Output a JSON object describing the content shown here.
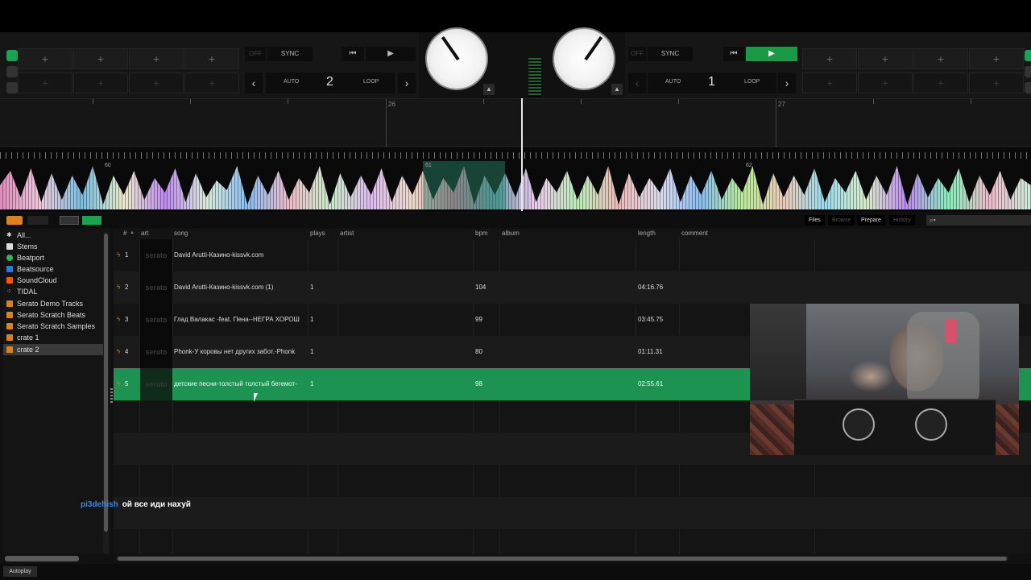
{
  "deck_left": {
    "sync_label": "SYNC",
    "off_label": "OFF",
    "auto_label": "AUTO",
    "loop_label": "LOOP",
    "loop_length": "2",
    "hotcue_label": "+"
  },
  "deck_right": {
    "sync_label": "SYNC",
    "off_label": "OFF",
    "auto_label": "AUTO",
    "loop_label": "LOOP",
    "loop_length": "1",
    "hotcue_label": "+"
  },
  "icons": {
    "prev_arrow": "‹",
    "next_arrow": "›",
    "cue": "⏮",
    "play": "▶",
    "eject": "▲",
    "bolt": "ϟ"
  },
  "overview": {
    "bar_labels": [
      "26",
      "27"
    ]
  },
  "waveform": {
    "bar_labels": [
      "60",
      "61",
      "62"
    ]
  },
  "library": {
    "tabs": [
      "Files",
      "Browse",
      "Prepare",
      "History"
    ],
    "search_icon": "search-icon"
  },
  "sidebar": {
    "items": [
      {
        "label": "All...",
        "icon": "star-icon",
        "color": "#dddddd"
      },
      {
        "label": "Stems",
        "icon": "stems-icon",
        "color": "#dddddd"
      },
      {
        "label": "Beatport",
        "icon": "beatport-icon",
        "color": "#3bb05a"
      },
      {
        "label": "Beatsource",
        "icon": "beatsource-icon",
        "color": "#2a7be0"
      },
      {
        "label": "SoundCloud",
        "icon": "soundcloud-icon",
        "color": "#ff5500"
      },
      {
        "label": "TIDAL",
        "icon": "tidal-icon",
        "color": "#dddddd"
      },
      {
        "label": "Serato Demo Tracks",
        "icon": "crate-icon",
        "color": "#d9821e"
      },
      {
        "label": "Serato Scratch Beats",
        "icon": "crate-icon",
        "color": "#d9821e"
      },
      {
        "label": "Serato Scratch Samples",
        "icon": "crate-icon",
        "color": "#d9821e"
      },
      {
        "label": "crate 1",
        "icon": "crate-icon",
        "color": "#d9821e"
      },
      {
        "label": "crate 2",
        "icon": "crate-icon",
        "color": "#d9821e"
      }
    ]
  },
  "table": {
    "headers": {
      "num": "#",
      "art": "art",
      "song": "song",
      "plays": "plays",
      "artist": "artist",
      "bpm": "bpm",
      "album": "album",
      "length": "length",
      "comment": "comment"
    },
    "art_placeholder": "serato",
    "rows": [
      {
        "num": "1",
        "song": "David Arutti-Казино-kissvk.com",
        "plays": "",
        "bpm": "",
        "length": ""
      },
      {
        "num": "2",
        "song": "David Arutti-Казино-kissvk.com (1)",
        "plays": "1",
        "bpm": "104",
        "length": "04:16.76"
      },
      {
        "num": "3",
        "song": "Глад Валакас -feat. Пена--НЕГРА ХОРОШ",
        "plays": "1",
        "bpm": "99",
        "length": "03:45.75"
      },
      {
        "num": "4",
        "song": "Phonk-У коровы нет других забот.-Phonk",
        "plays": "1",
        "bpm": "80",
        "length": "01:11.31"
      },
      {
        "num": "5",
        "song": "детские песни-толстый толстый бегемот-",
        "plays": "1",
        "bpm": "98",
        "length": "02:55.61"
      }
    ]
  },
  "chat": {
    "user": "pi3dehish",
    "message": "ой все иди нахуй"
  },
  "footer": {
    "autoplay_label": "Autoplay"
  }
}
